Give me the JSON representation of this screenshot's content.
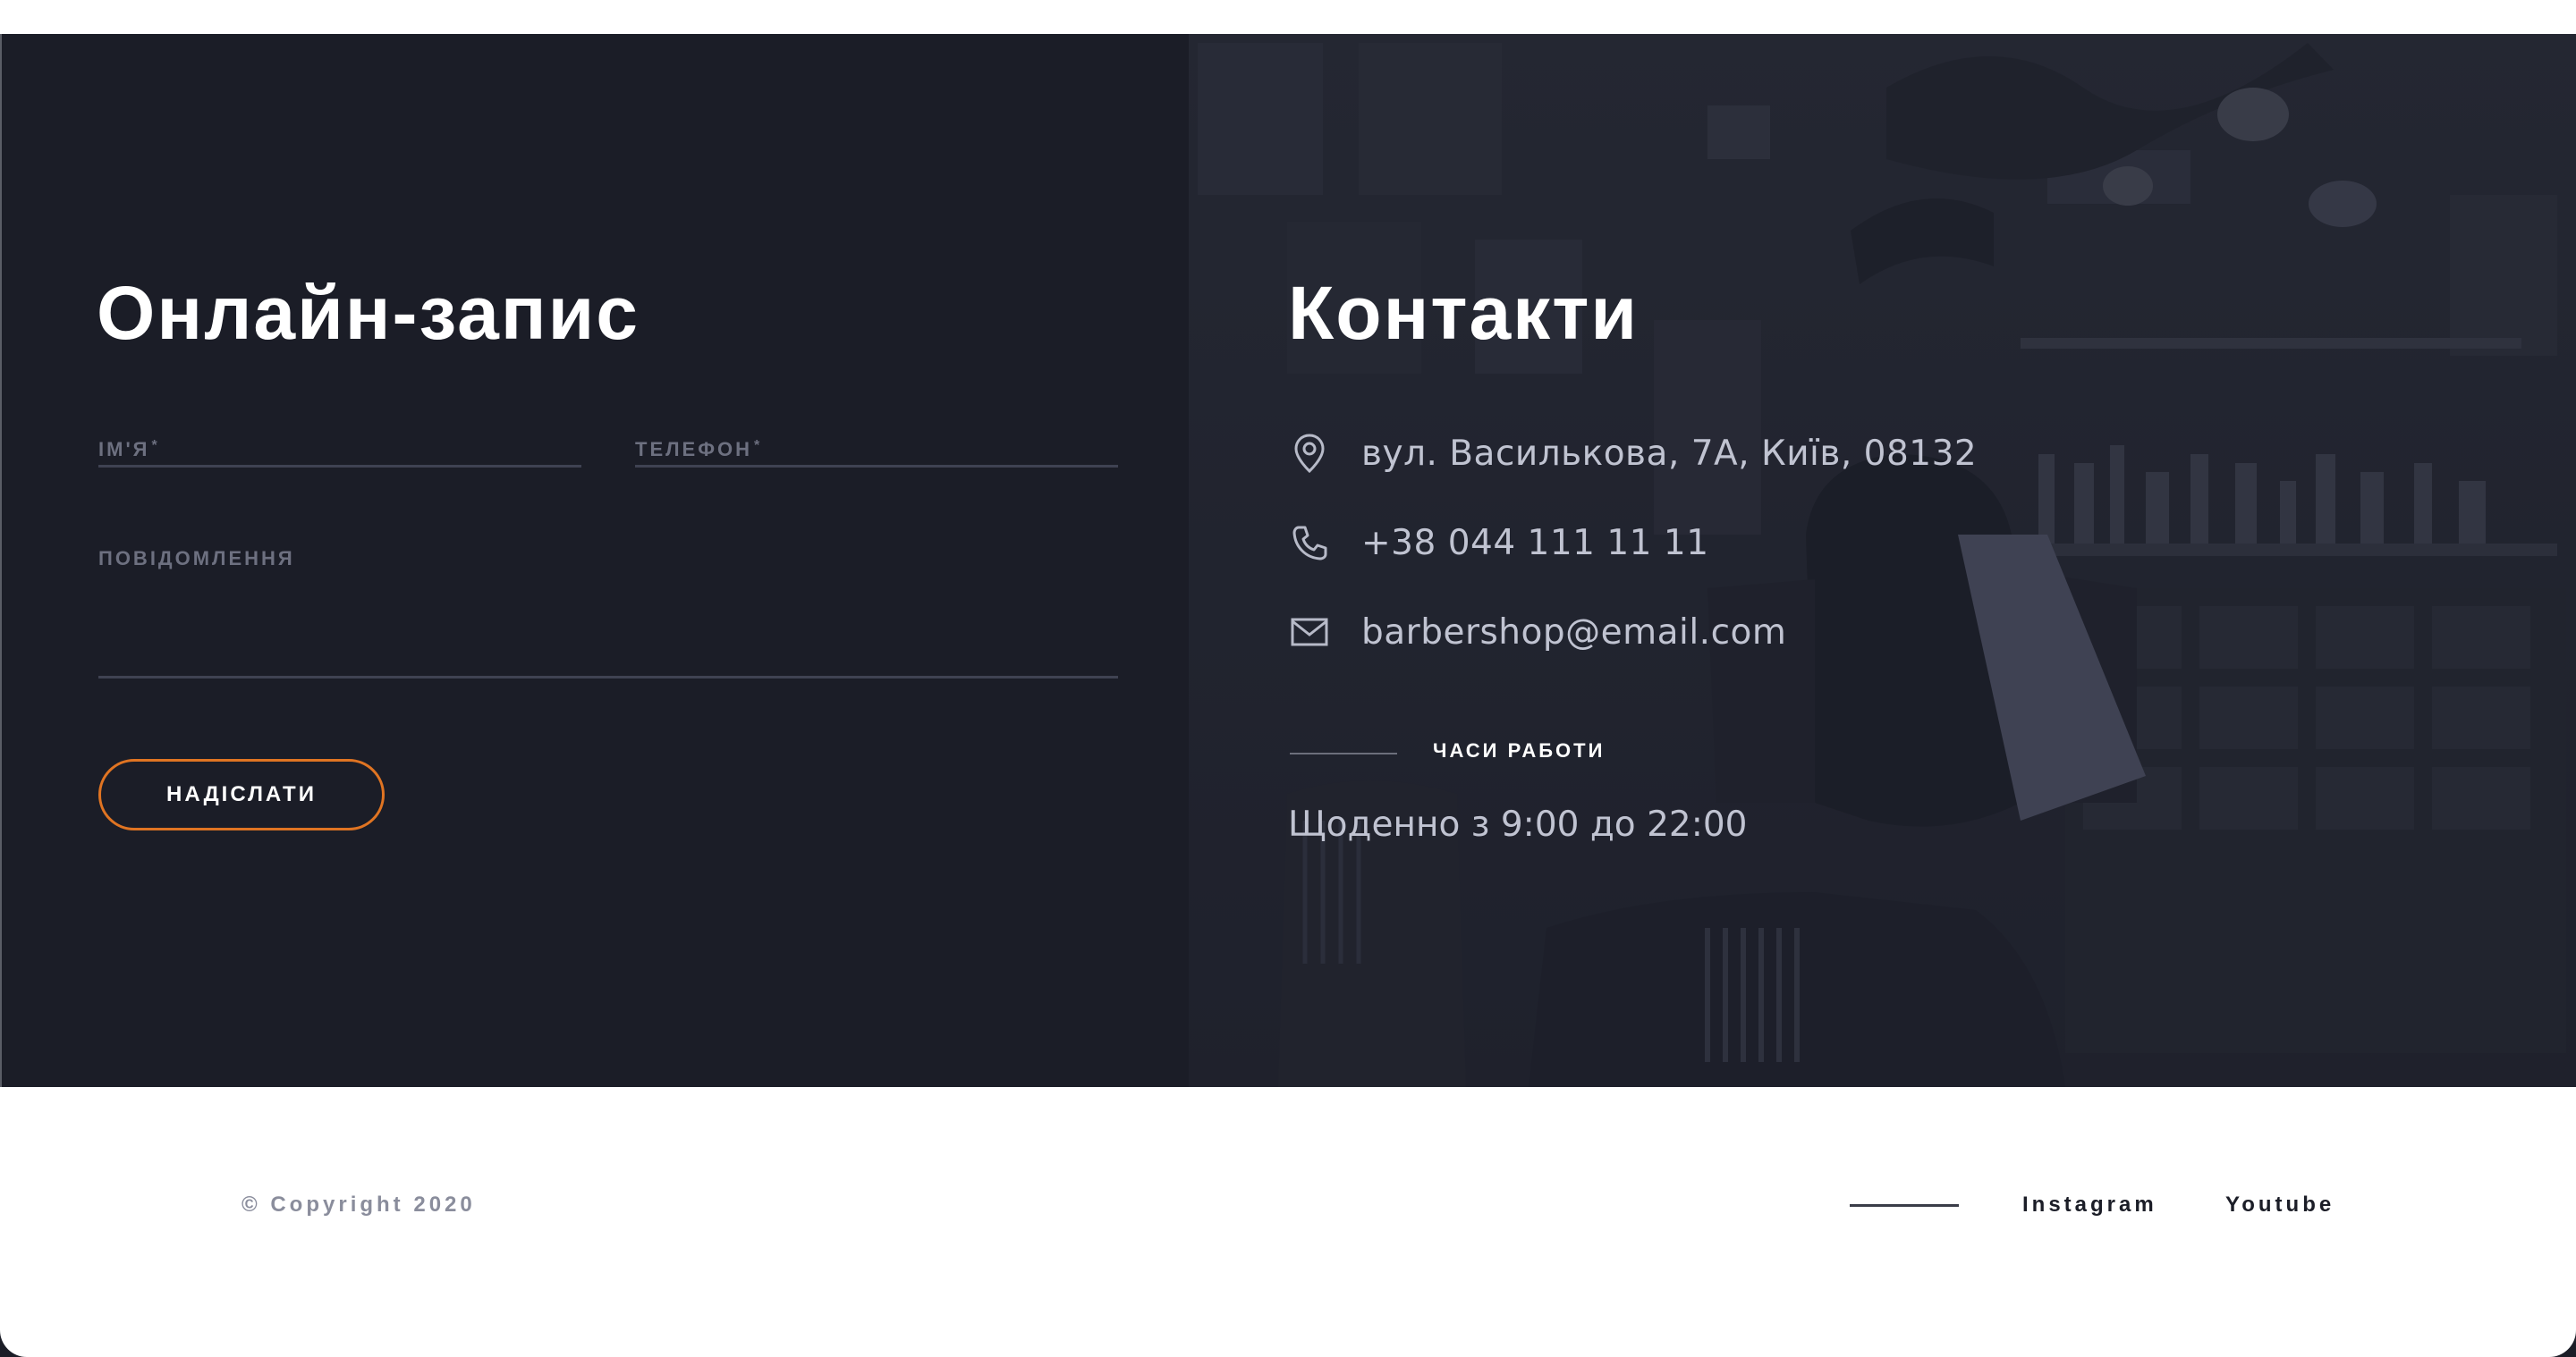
{
  "booking": {
    "title": "Онлайн-запис",
    "name_label": "ІМ'Я",
    "phone_label": "ТЕЛЕФОН",
    "required_mark": "*",
    "message_label": "ПОВІДОМЛЕННЯ",
    "submit_label": "НАДІСЛАТИ"
  },
  "contacts": {
    "title": "Контакти",
    "address": "вул. Василькова, 7А, Київ, 08132",
    "phone": "+38 044 111 11 11",
    "email": "barbershop@email.com",
    "hours_label": "ЧАСИ РАБОТИ",
    "hours_value": "Щоденно з 9:00 до 22:00"
  },
  "footer": {
    "copyright": "© Copyright 2020",
    "links": [
      "Instagram",
      "Youtube"
    ]
  },
  "icons": {
    "address": "location-pin-icon",
    "phone": "phone-icon",
    "email": "envelope-icon"
  },
  "colors": {
    "background": "#1b1d27",
    "accent": "#e07422",
    "text_muted": "#c0c3d1",
    "footer_bg": "#ffffff"
  }
}
